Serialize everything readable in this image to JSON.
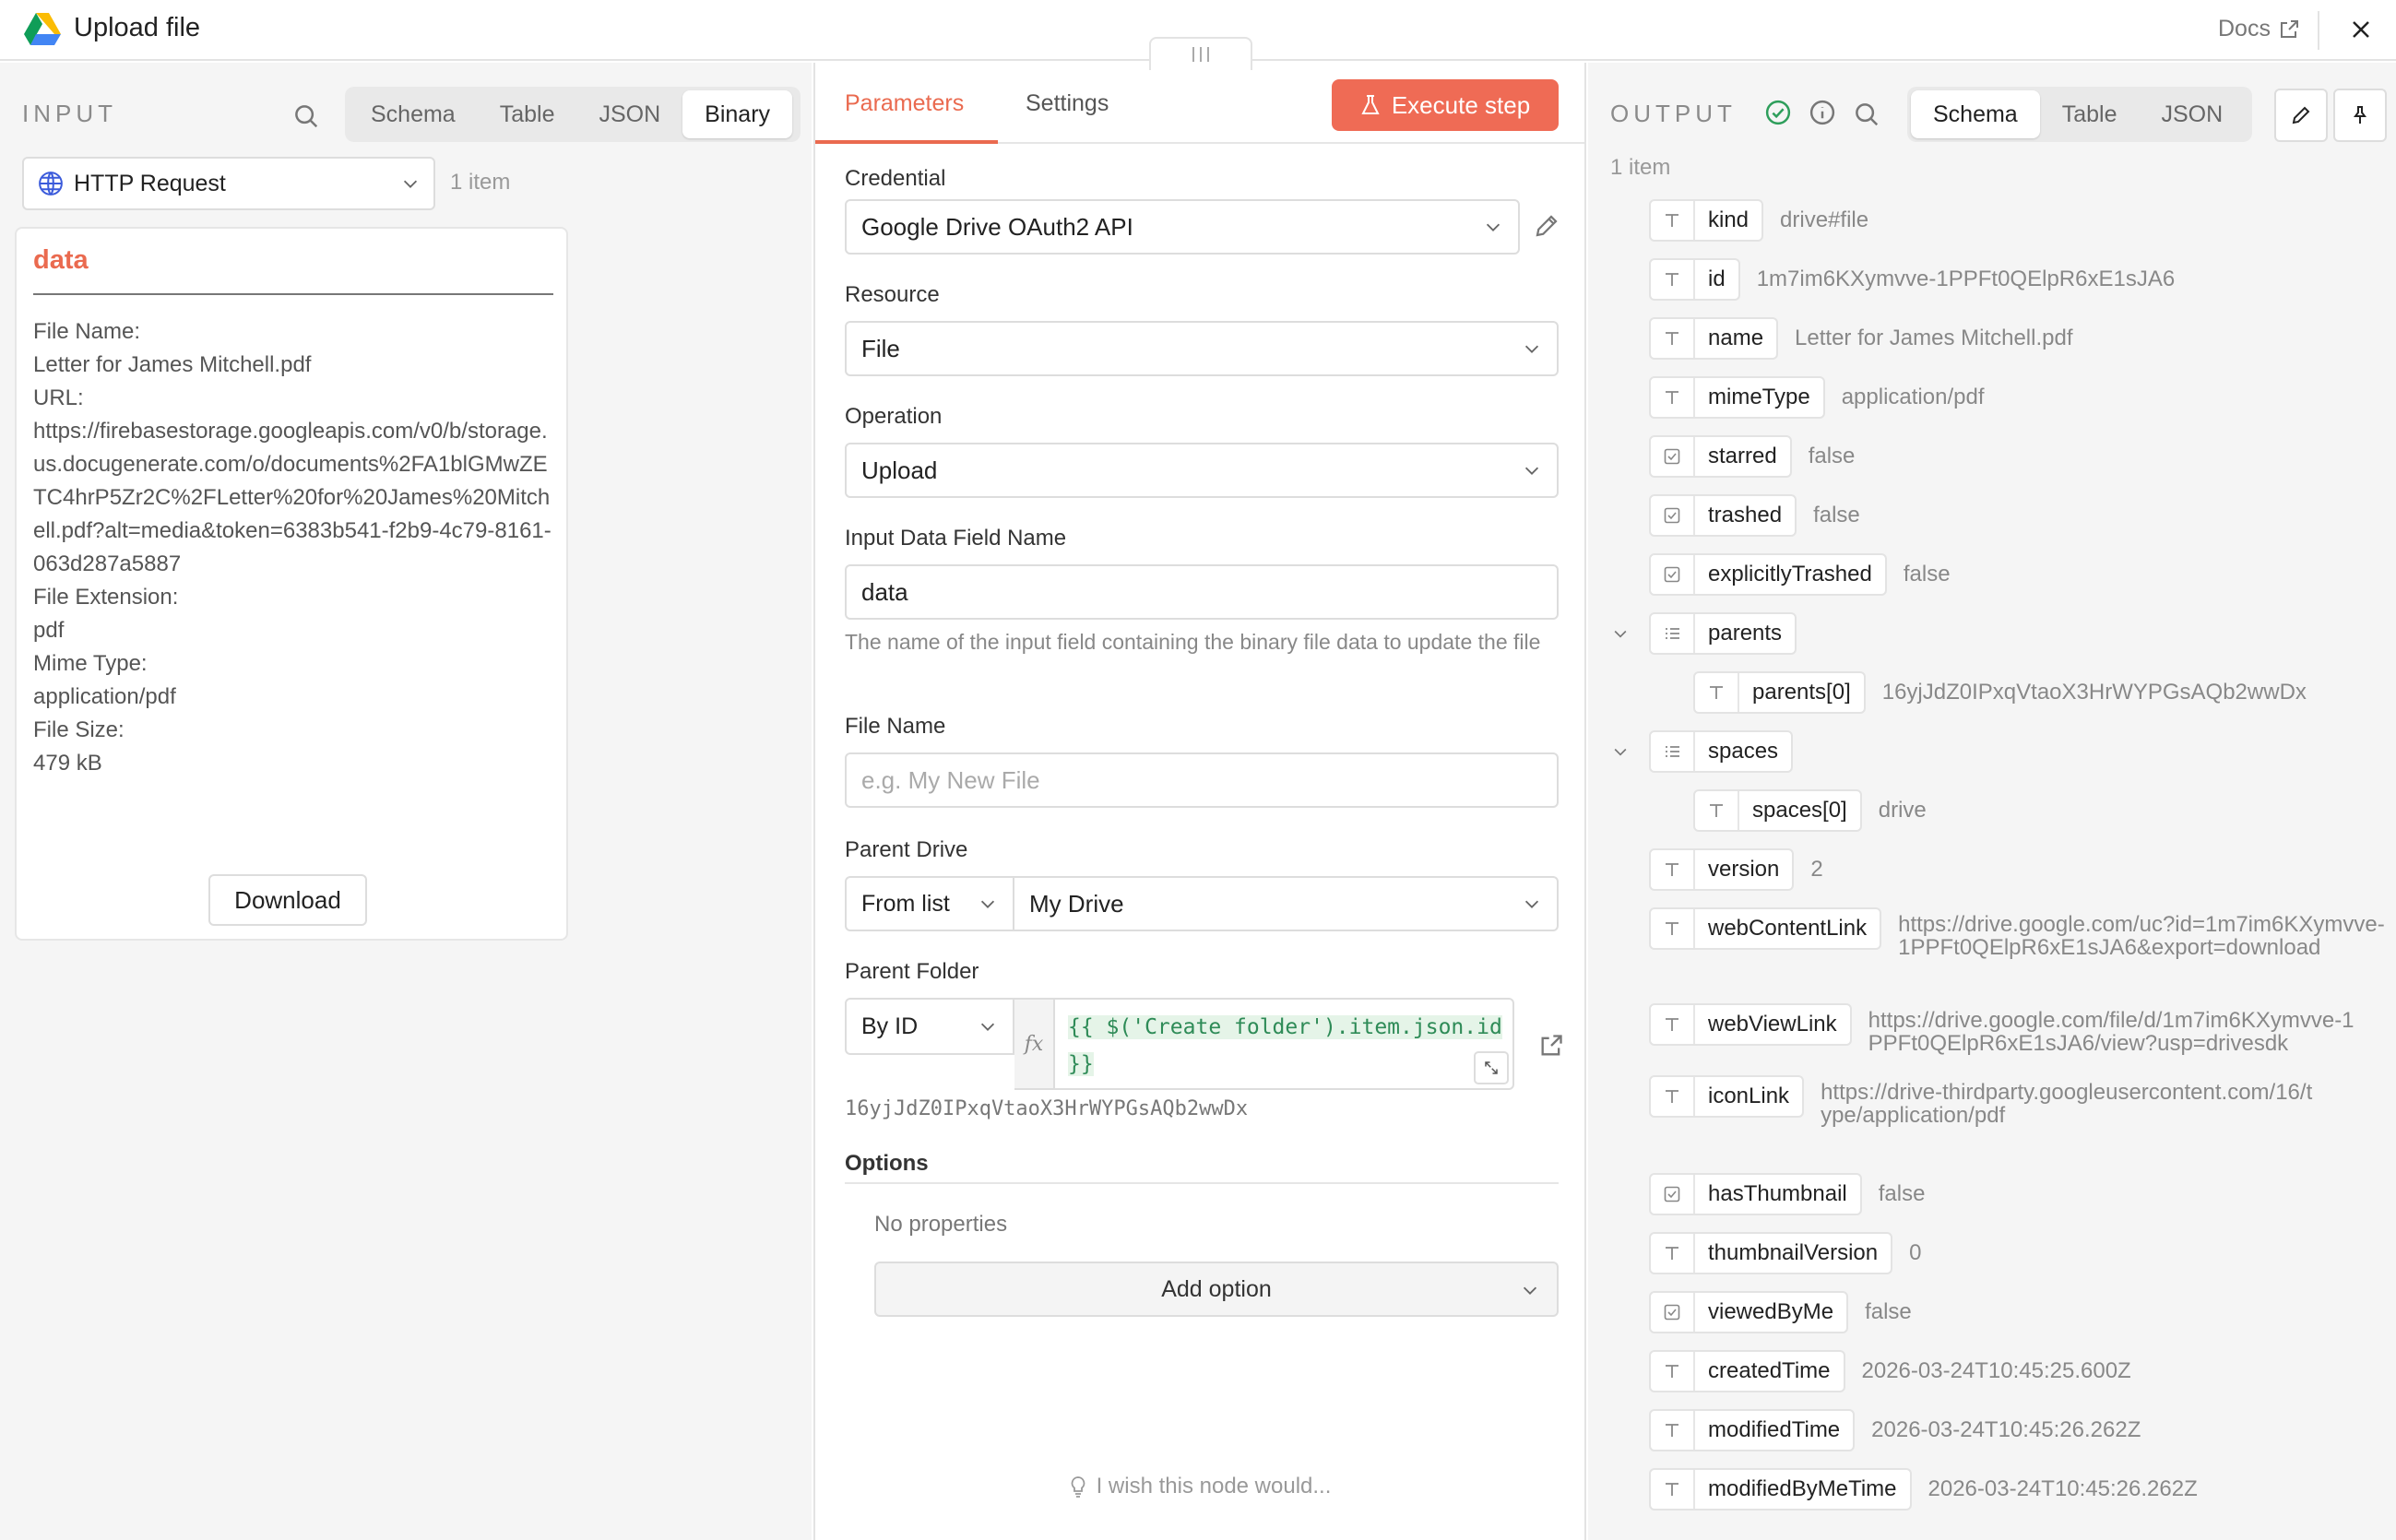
{
  "header": {
    "title": "Upload file",
    "docs_label": "Docs"
  },
  "input": {
    "title": "INPUT",
    "view_tabs": [
      "Schema",
      "Table",
      "JSON",
      "Binary"
    ],
    "active_tab": "Binary",
    "node_select": "HTTP Request",
    "item_count": "1 item",
    "binary": {
      "name": "data",
      "lines": [
        "File Name:",
        "Letter for James Mitchell.pdf",
        "URL:",
        "https://firebasestorage.googleapis.com/v0/b/storage.us.docugenerate.com/o/documents%2FA1blGMwZETC4hrP5Zr2C%2FLetter%20for%20James%20Mitchell.pdf?alt=media&token=6383b541-f2b9-4c79-8161-063d287a5887",
        "File Extension:",
        "pdf",
        "Mime Type:",
        "application/pdf",
        "File Size:",
        "479 kB"
      ],
      "download_label": "Download"
    }
  },
  "params": {
    "tabs": [
      "Parameters",
      "Settings"
    ],
    "active_tab": "Parameters",
    "execute_label": "Execute step",
    "credential_label": "Credential",
    "credential_value": "Google Drive OAuth2 API",
    "resource_label": "Resource",
    "resource_value": "File",
    "operation_label": "Operation",
    "operation_value": "Upload",
    "input_field_label": "Input Data Field Name",
    "input_field_value": "data",
    "input_field_hint": "The name of the input field containing the binary file data to update the file",
    "file_name_label": "File Name",
    "file_name_placeholder": "e.g. My New File",
    "parent_drive_label": "Parent Drive",
    "parent_drive_mode": "From list",
    "parent_drive_value": "My Drive",
    "parent_folder_label": "Parent Folder",
    "parent_folder_mode": "By ID",
    "parent_folder_expr": "{{ $('Create folder').item.json.id }}",
    "parent_folder_resolved": "16yjJdZ0IPxqVtaoX3HrWYPGsAQb2wwDx",
    "options_label": "Options",
    "no_props": "No properties",
    "add_option": "Add option",
    "wish": "I wish this node would..."
  },
  "output": {
    "title": "OUTPUT",
    "view_tabs": [
      "Schema",
      "Table",
      "JSON"
    ],
    "active_tab": "Schema",
    "item_count": "1 item",
    "fields": [
      {
        "key": "kind",
        "type": "string",
        "value": "drive#file"
      },
      {
        "key": "id",
        "type": "string",
        "value": "1m7im6KXymvve-1PPFt0QElpR6xE1sJA6"
      },
      {
        "key": "name",
        "type": "string",
        "value": "Letter for James Mitchell.pdf"
      },
      {
        "key": "mimeType",
        "type": "string",
        "value": "application/pdf"
      },
      {
        "key": "starred",
        "type": "boolean",
        "value": "false"
      },
      {
        "key": "trashed",
        "type": "boolean",
        "value": "false"
      },
      {
        "key": "explicitlyTrashed",
        "type": "boolean",
        "value": "false"
      },
      {
        "key": "parents",
        "type": "array",
        "value": ""
      },
      {
        "key": "parents[0]",
        "type": "string",
        "value": "16yjJdZ0IPxqVtaoX3HrWYPGsAQb2wwDx"
      },
      {
        "key": "spaces",
        "type": "array",
        "value": ""
      },
      {
        "key": "spaces[0]",
        "type": "string",
        "value": "drive"
      },
      {
        "key": "version",
        "type": "string",
        "value": "2"
      },
      {
        "key": "webContentLink",
        "type": "string",
        "value": "https://drive.google.com/uc?id=1m7im6KXymvve-1PPFt0QElpR6xE1sJA6&export=download"
      },
      {
        "key": "webViewLink",
        "type": "string",
        "value": "https://drive.google.com/file/d/1m7im6KXymvve-1PPFt0QElpR6xE1sJA6/view?usp=drivesdk"
      },
      {
        "key": "iconLink",
        "type": "string",
        "value": "https://drive-thirdparty.googleusercontent.com/16/type/application/pdf"
      },
      {
        "key": "hasThumbnail",
        "type": "boolean",
        "value": "false"
      },
      {
        "key": "thumbnailVersion",
        "type": "string",
        "value": "0"
      },
      {
        "key": "viewedByMe",
        "type": "boolean",
        "value": "false"
      },
      {
        "key": "createdTime",
        "type": "string",
        "value": "2026-03-24T10:45:25.600Z"
      },
      {
        "key": "modifiedTime",
        "type": "string",
        "value": "2026-03-24T10:45:26.262Z"
      },
      {
        "key": "modifiedByMeTime",
        "type": "string",
        "value": "2026-03-24T10:45:26.262Z"
      }
    ]
  },
  "colors": {
    "accent": "#ea6a4f",
    "execute_button": "#ef6b55",
    "success": "#2e9e5b",
    "expression_text": "#2e8b57",
    "expression_bg": "#e5f4e8"
  },
  "icons": {
    "app": "google-drive-icon",
    "docs": "external-link-icon",
    "close": "close-icon",
    "search": "search-icon",
    "node": "globe-icon",
    "edit": "pencil-icon",
    "execute": "flask-icon",
    "status_ok": "check-circle-icon",
    "info": "info-icon",
    "pin": "pin-icon",
    "type_string": "text-type-icon",
    "type_boolean": "checkbox-type-icon",
    "type_array": "list-type-icon",
    "wish": "lightbulb-icon"
  }
}
